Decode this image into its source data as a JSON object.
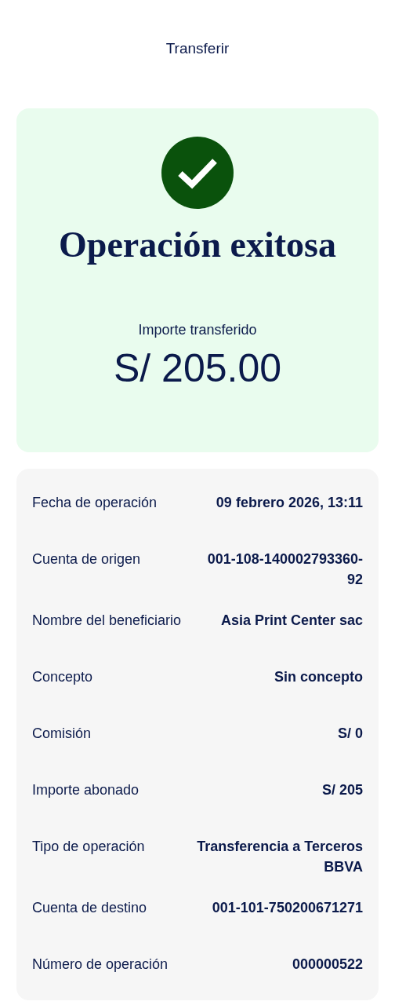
{
  "header": {
    "title": "Transferir"
  },
  "success": {
    "title": "Operación exitosa",
    "amount_label": "Importe transferido",
    "amount": "S/ 205.00"
  },
  "details": [
    {
      "label": "Fecha de operación",
      "value": "09 febrero 2026, 13:11"
    },
    {
      "label": "Cuenta de origen",
      "value": "001-108-140002793360-92"
    },
    {
      "label": "Nombre del beneficiario",
      "value": "Asia Print Center sac"
    },
    {
      "label": "Concepto",
      "value": "Sin concepto"
    },
    {
      "label": "Comisión",
      "value": "S/ 0"
    },
    {
      "label": "Importe abonado",
      "value": "S/ 205"
    },
    {
      "label": "Tipo de operación",
      "value": "Transferencia a Terceros BBVA"
    },
    {
      "label": "Cuenta de destino",
      "value": "001-101-750200671271"
    },
    {
      "label": "Número de operación",
      "value": "000000522"
    }
  ]
}
